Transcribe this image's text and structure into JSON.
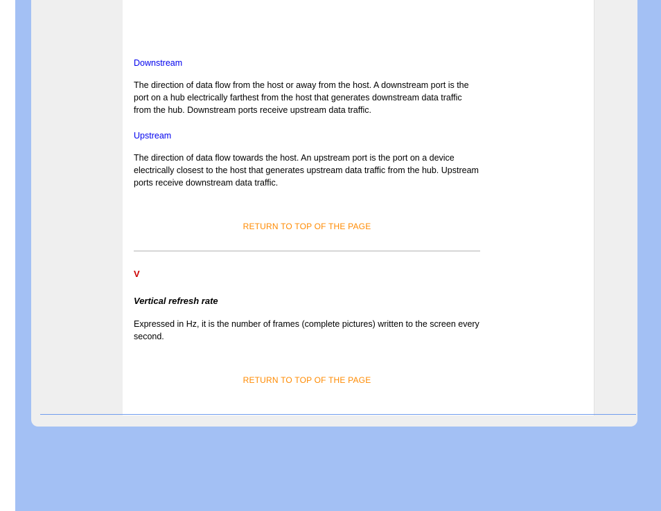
{
  "terms": {
    "downstream": {
      "label": "Downstream",
      "definition": "The direction of data flow from the host or away from the host. A downstream port is the port on a hub electrically farthest from the host that generates downstream data traffic from the hub. Downstream ports receive upstream data traffic."
    },
    "upstream": {
      "label": "Upstream",
      "definition": "The direction of data flow towards the host. An upstream port is the port on a device electrically closest to the host that generates upstream data traffic from the hub. Upstream ports receive downstream data traffic."
    }
  },
  "return_link_label": "RETURN TO TOP OF THE PAGE",
  "section_v": {
    "letter": "V",
    "term": "Vertical refresh rate",
    "definition": "Expressed in Hz, it is the number of frames (complete pictures) written to the screen every second."
  }
}
